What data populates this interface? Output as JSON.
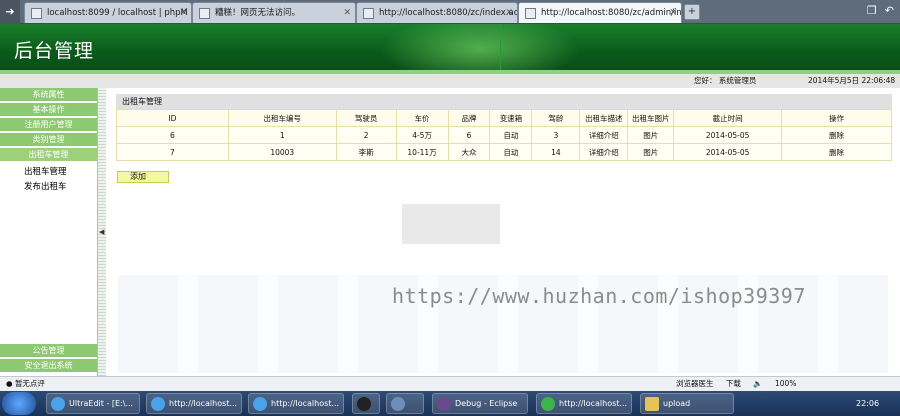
{
  "browser": {
    "tabs": [
      {
        "label": "localhost:8099 / localhost | phpM"
      },
      {
        "label": "糟糕！网页无法访问。"
      },
      {
        "label": "http://localhost:8080/zc/index.acti"
      },
      {
        "label": "http://localhost:8080/zc/admin/in"
      }
    ],
    "new_tab": "+"
  },
  "header": {
    "title": "后台管理"
  },
  "userbar": {
    "greeting": "您好：  系统管理员",
    "datetime": "2014年5月5日   22:06:48"
  },
  "sidebar": {
    "menu": [
      {
        "label": "系统属性"
      },
      {
        "label": "基本操作"
      },
      {
        "label": "注册用户管理"
      },
      {
        "label": "类别管理"
      },
      {
        "label": "出租车管理"
      }
    ],
    "submenu": [
      {
        "label": "出租车管理"
      },
      {
        "label": "发布出租车"
      }
    ],
    "bottom_menu": [
      {
        "label": "公告管理"
      },
      {
        "label": "安全退出系统"
      }
    ]
  },
  "main": {
    "panel_title": "出租车管理",
    "columns": [
      "ID",
      "出租车编号",
      "驾驶员",
      "车价",
      "品牌",
      "变速箱",
      "驾龄",
      "出租车描述",
      "出租车图片",
      "截止时间",
      "操作"
    ],
    "rows": [
      [
        "6",
        "1",
        "2",
        "4-5万",
        "6",
        "自动",
        "3",
        "详细介绍",
        "图片",
        "2014-05-05",
        "删除"
      ],
      [
        "7",
        "10003",
        "李斯",
        "10-11万",
        "大众",
        "自动",
        "14",
        "详细介绍",
        "图片",
        "2014-05-05",
        "删除"
      ]
    ],
    "add_button": "添加"
  },
  "watermark": "https://www.huzhan.com/ishop39397",
  "statusbar": {
    "left": "暂无点评",
    "browser_doctor": "浏览器医生",
    "download": "下载",
    "zoom": "100%"
  },
  "taskbar": {
    "items": [
      {
        "label": "UltraEdit - [E:\\..."
      },
      {
        "label": "http://localhost..."
      },
      {
        "label": "http://localhost..."
      },
      {
        "label": "Debug - Eclipse"
      },
      {
        "label": "http://localhost..."
      },
      {
        "label": "upload"
      }
    ],
    "clock": "22:06"
  },
  "colors": {
    "header_green": "#0c5b1b",
    "menu_green": "#8cc971",
    "table_border": "#e6dfa8"
  }
}
